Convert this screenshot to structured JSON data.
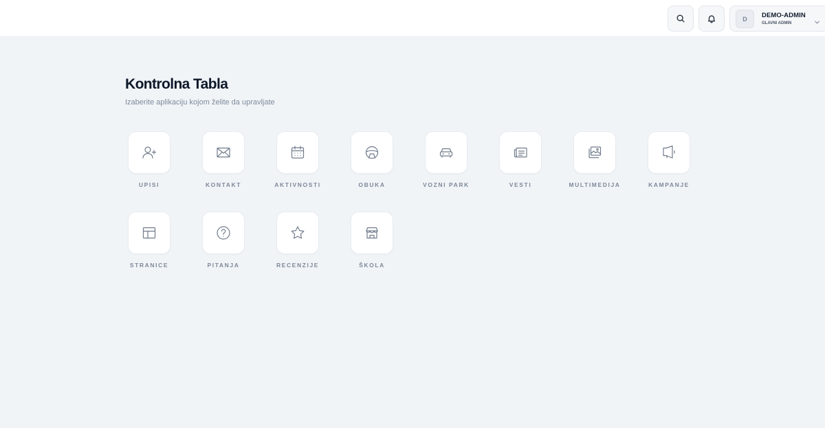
{
  "header": {
    "search_icon": "search-icon",
    "bell_icon": "bell-icon",
    "user": {
      "avatar_initial": "D",
      "name": "DEMO-ADMIN",
      "role": "GLAVNI ADMIN"
    }
  },
  "main": {
    "title": "Kontrolna Tabla",
    "subtitle": "Izaberite aplikaciju kojom želite da upravljate",
    "apps": [
      {
        "label": "UPISI",
        "icon": "user-plus-icon"
      },
      {
        "label": "KONTAKT",
        "icon": "mail-icon"
      },
      {
        "label": "AKTIVNOSTI",
        "icon": "calendar-icon"
      },
      {
        "label": "OBUKA",
        "icon": "steering-wheel-icon"
      },
      {
        "label": "VOZNI PARK",
        "icon": "car-icon"
      },
      {
        "label": "VESTI",
        "icon": "newspaper-icon"
      },
      {
        "label": "MULTIMEDIJA",
        "icon": "images-icon"
      },
      {
        "label": "KAMPANJE",
        "icon": "megaphone-icon"
      },
      {
        "label": "STRANICE",
        "icon": "layout-icon"
      },
      {
        "label": "PITANJA",
        "icon": "question-icon"
      },
      {
        "label": "RECENZIJE",
        "icon": "star-icon"
      },
      {
        "label": "ŠKOLA",
        "icon": "store-icon"
      }
    ]
  }
}
